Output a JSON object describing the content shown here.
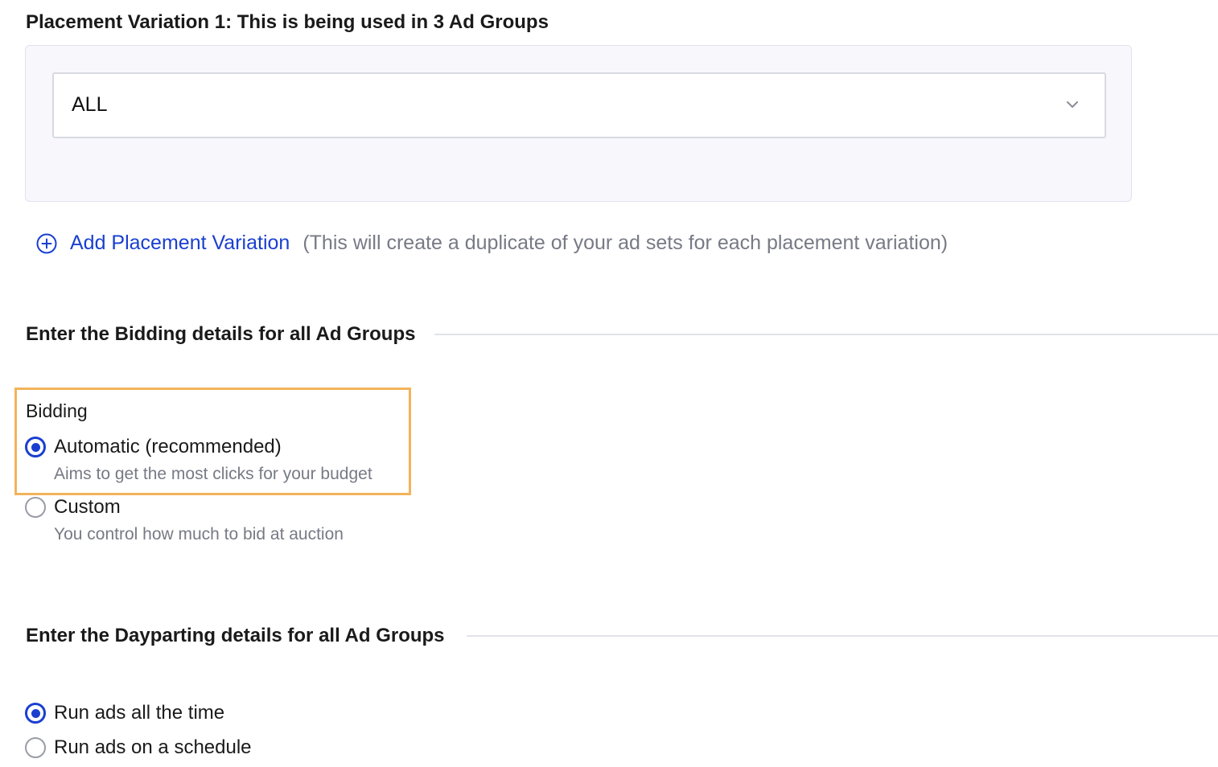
{
  "placement": {
    "title": "Placement Variation 1: This is being used in 3 Ad Groups",
    "select_value": "ALL",
    "add_link": "Add Placement Variation",
    "add_note": "(This will create a duplicate of your ad sets for each placement variation)"
  },
  "bidding": {
    "section_title": "Enter the Bidding details for all Ad Groups",
    "field_label": "Bidding",
    "options": [
      {
        "label": "Automatic (recommended)",
        "description": "Aims to get the most clicks for your budget",
        "checked": true
      },
      {
        "label": "Custom",
        "description": "You control how much to bid at auction",
        "checked": false
      }
    ]
  },
  "dayparting": {
    "section_title": "Enter the Dayparting details for all Ad Groups",
    "options": [
      {
        "label": "Run ads all the time",
        "checked": true
      },
      {
        "label": "Run ads on a schedule",
        "checked": false
      }
    ]
  },
  "colors": {
    "accent": "#1a3fd0",
    "highlight_border": "#f2b35a",
    "panel_bg": "#f7f7fc",
    "muted_text": "#777a85"
  },
  "icons": {
    "select_chevron": "chevron-down-icon",
    "add_variation": "plus-circle-icon"
  }
}
